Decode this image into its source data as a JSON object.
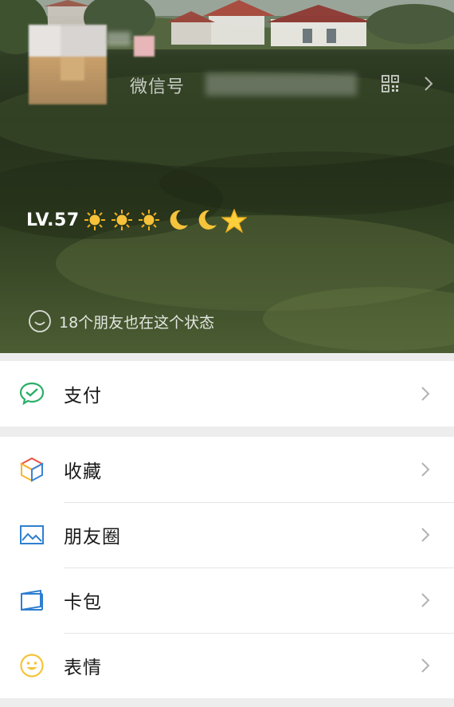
{
  "profile": {
    "wechat_id_label": "微信号",
    "status_text": "LV.57",
    "status_emojis": [
      "☀️",
      "☀️",
      "☀️",
      "🌙",
      "🌙",
      "⭐"
    ],
    "friends_status_text": "18个朋友也在这个状态"
  },
  "menu": {
    "group1": [
      {
        "label": "支付",
        "icon": "wechat-pay-icon"
      }
    ],
    "group2": [
      {
        "label": "收藏",
        "icon": "favorites-cube-icon"
      },
      {
        "label": "朋友圈",
        "icon": "moments-image-icon"
      },
      {
        "label": "卡包",
        "icon": "card-wallet-icon"
      },
      {
        "label": "表情",
        "icon": "sticker-smile-icon"
      }
    ]
  },
  "colors": {
    "pay_green": "#2aae67",
    "moments_blue": "#2e7fd1",
    "sticker_yellow": "#f5c43b",
    "chevron": "#b2b2b2"
  }
}
